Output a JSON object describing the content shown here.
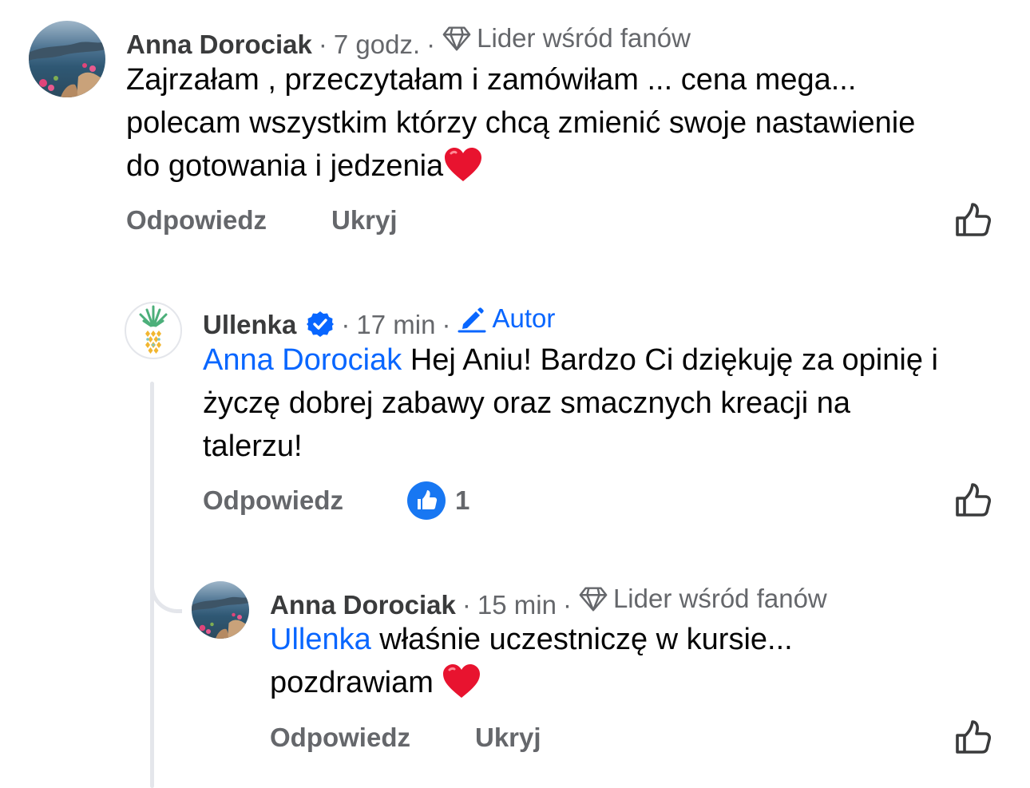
{
  "colors": {
    "link": "#0866ff",
    "meta": "#65676b",
    "name": "#3a3b3c",
    "text": "#050505",
    "thread_line": "#e4e6eb",
    "heart": "#e8132f"
  },
  "comments": [
    {
      "author": "Anna Dorociak",
      "time": "7 godz.",
      "badge": "Lider wśród fanów",
      "badge_icon": "diamond-icon",
      "text_line1": "Zajrzałam , przeczytałam i zamówiłam ... cena mega...",
      "text_line2": "polecam wszystkim którzy chcą zmienić swoje nastawienie",
      "text_line3": "do gotowania i jedzenia",
      "emoji": "❤️",
      "reply_label": "Odpowiedz",
      "hide_label": "Ukryj"
    },
    {
      "author": "Ullenka",
      "verified_icon": "verified-badge-icon",
      "time": "17 min",
      "badge": "Autor",
      "badge_icon": "pencil-icon",
      "mention": "Anna Dorociak",
      "text_line1": "Hej Aniu! Bardzo Ci dziękuję za opinię i",
      "text_line2": "życzę dobrej zabawy oraz smacznych kreacji na",
      "text_line3": "talerzu!",
      "reply_label": "Odpowiedz",
      "reaction_count": "1"
    },
    {
      "author": "Anna Dorociak",
      "time": "15 min",
      "badge": "Lider wśród fanów",
      "badge_icon": "diamond-icon",
      "mention": "Ullenka",
      "text_line1": "właśnie uczestniczę w kursie...",
      "text_line2": "pozdrawiam",
      "emoji": "❤️",
      "reply_label": "Odpowiedz",
      "hide_label": "Ukryj"
    }
  ]
}
